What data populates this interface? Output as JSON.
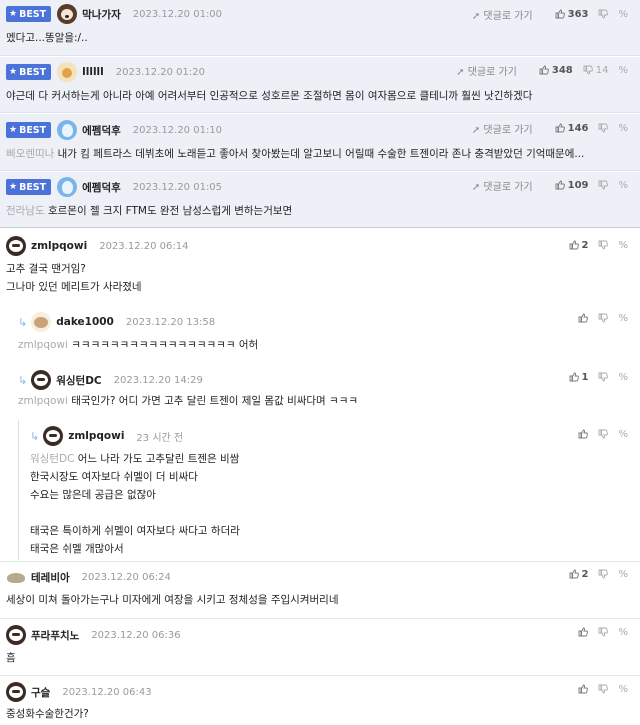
{
  "actions": {
    "reply_link": "댓글로 가기"
  },
  "icons": {
    "like": "thumbs-up-icon",
    "dislike": "thumbs-down-icon",
    "link": "link-icon",
    "reply_arrow": "reply-arrow-icon",
    "best_star": "star-icon"
  },
  "colors": {
    "best_badge": "#4a72d8",
    "best_bg": "#eef0f8",
    "mention": "#aaaaaa"
  },
  "best_comments": [
    {
      "badge": "BEST",
      "nick": "막나가자",
      "date": "2023.12.20 01:00",
      "likes": "363",
      "dislikes": "",
      "text": "멨다고...똥알을:/..",
      "mention": ""
    },
    {
      "badge": "BEST",
      "nick": "llllll",
      "date": "2023.12.20 01:20",
      "likes": "348",
      "dislikes": "14",
      "text": "야근데 다 커서하는게 아니라 아예 어려서부터 인공적으로 성호르몬 조절하면 몸이 여자몸으로 클테니까 훨씬 낫긴하겠다",
      "mention": ""
    },
    {
      "badge": "BEST",
      "nick": "에펨덕후",
      "date": "2023.12.20 01:10",
      "likes": "146",
      "dislikes": "",
      "mention": "삐오렌띠나",
      "text": " 내가 킴 페트라스 데뷔초에 노래듣고 좋아서 찾아봤는데 알고보니 어릴때 수술한 트젠이라 존나 충격받았던 기억때문에..."
    },
    {
      "badge": "BEST",
      "nick": "에펨덕후",
      "date": "2023.12.20 01:05",
      "likes": "109",
      "dislikes": "",
      "mention": "전라남도",
      "text": " 호르몬이 젤 크지 FTM도 완전 남성스럽게 변하는거보면"
    }
  ],
  "comments": [
    {
      "nick": "zmlpqowi",
      "date": "2023.12.20 06:14",
      "likes": "2",
      "mention": "",
      "text": "고추 결국 땐거임?\n그나마 있던 메리트가 사라졌네"
    },
    {
      "nick": "dake1000",
      "date": "2023.12.20 13:58",
      "likes": "",
      "mention": "zmlpqowi",
      "text": " ㅋㅋㅋㅋㅋㅋㅋㅋㅋㅋㅋㅋㅋㅋㅋㅋㅋ 어허"
    },
    {
      "nick": "워싱턴DC",
      "date": "2023.12.20 14:29",
      "likes": "1",
      "mention": "zmlpqowi",
      "text": " 태국인가? 어디 가면 고추 달린 트젠이 제일 몸값 비싸다며 ㅋㅋㅋ"
    },
    {
      "nick": "zmlpqowi",
      "date": "23 시간 전",
      "likes": "",
      "mention": "워싱턴DC",
      "text": " 어느 나라 가도 고추달린 트젠은 비쌈\n한국시장도 여자보다 쉬멜이 더 비싸다\n수요는 많은데 공급은 없잖아\n\n태국은 특이하게 쉬멜이 여자보다 싸다고 하더라\n태국은 쉬멜 개많아서"
    },
    {
      "nick": "테레비아",
      "date": "2023.12.20 06:24",
      "likes": "2",
      "mention": "",
      "text": "세상이 미쳐 돌아가는구나 미자에게 여장을 시키고 정체성을 주입시켜버리네"
    },
    {
      "nick": "푸라푸치노",
      "date": "2023.12.20 06:36",
      "likes": "",
      "mention": "",
      "text": "흠"
    },
    {
      "nick": "구슬",
      "date": "2023.12.20 06:43",
      "likes": "",
      "mention": "",
      "text": "중성화수술한건가?"
    }
  ]
}
